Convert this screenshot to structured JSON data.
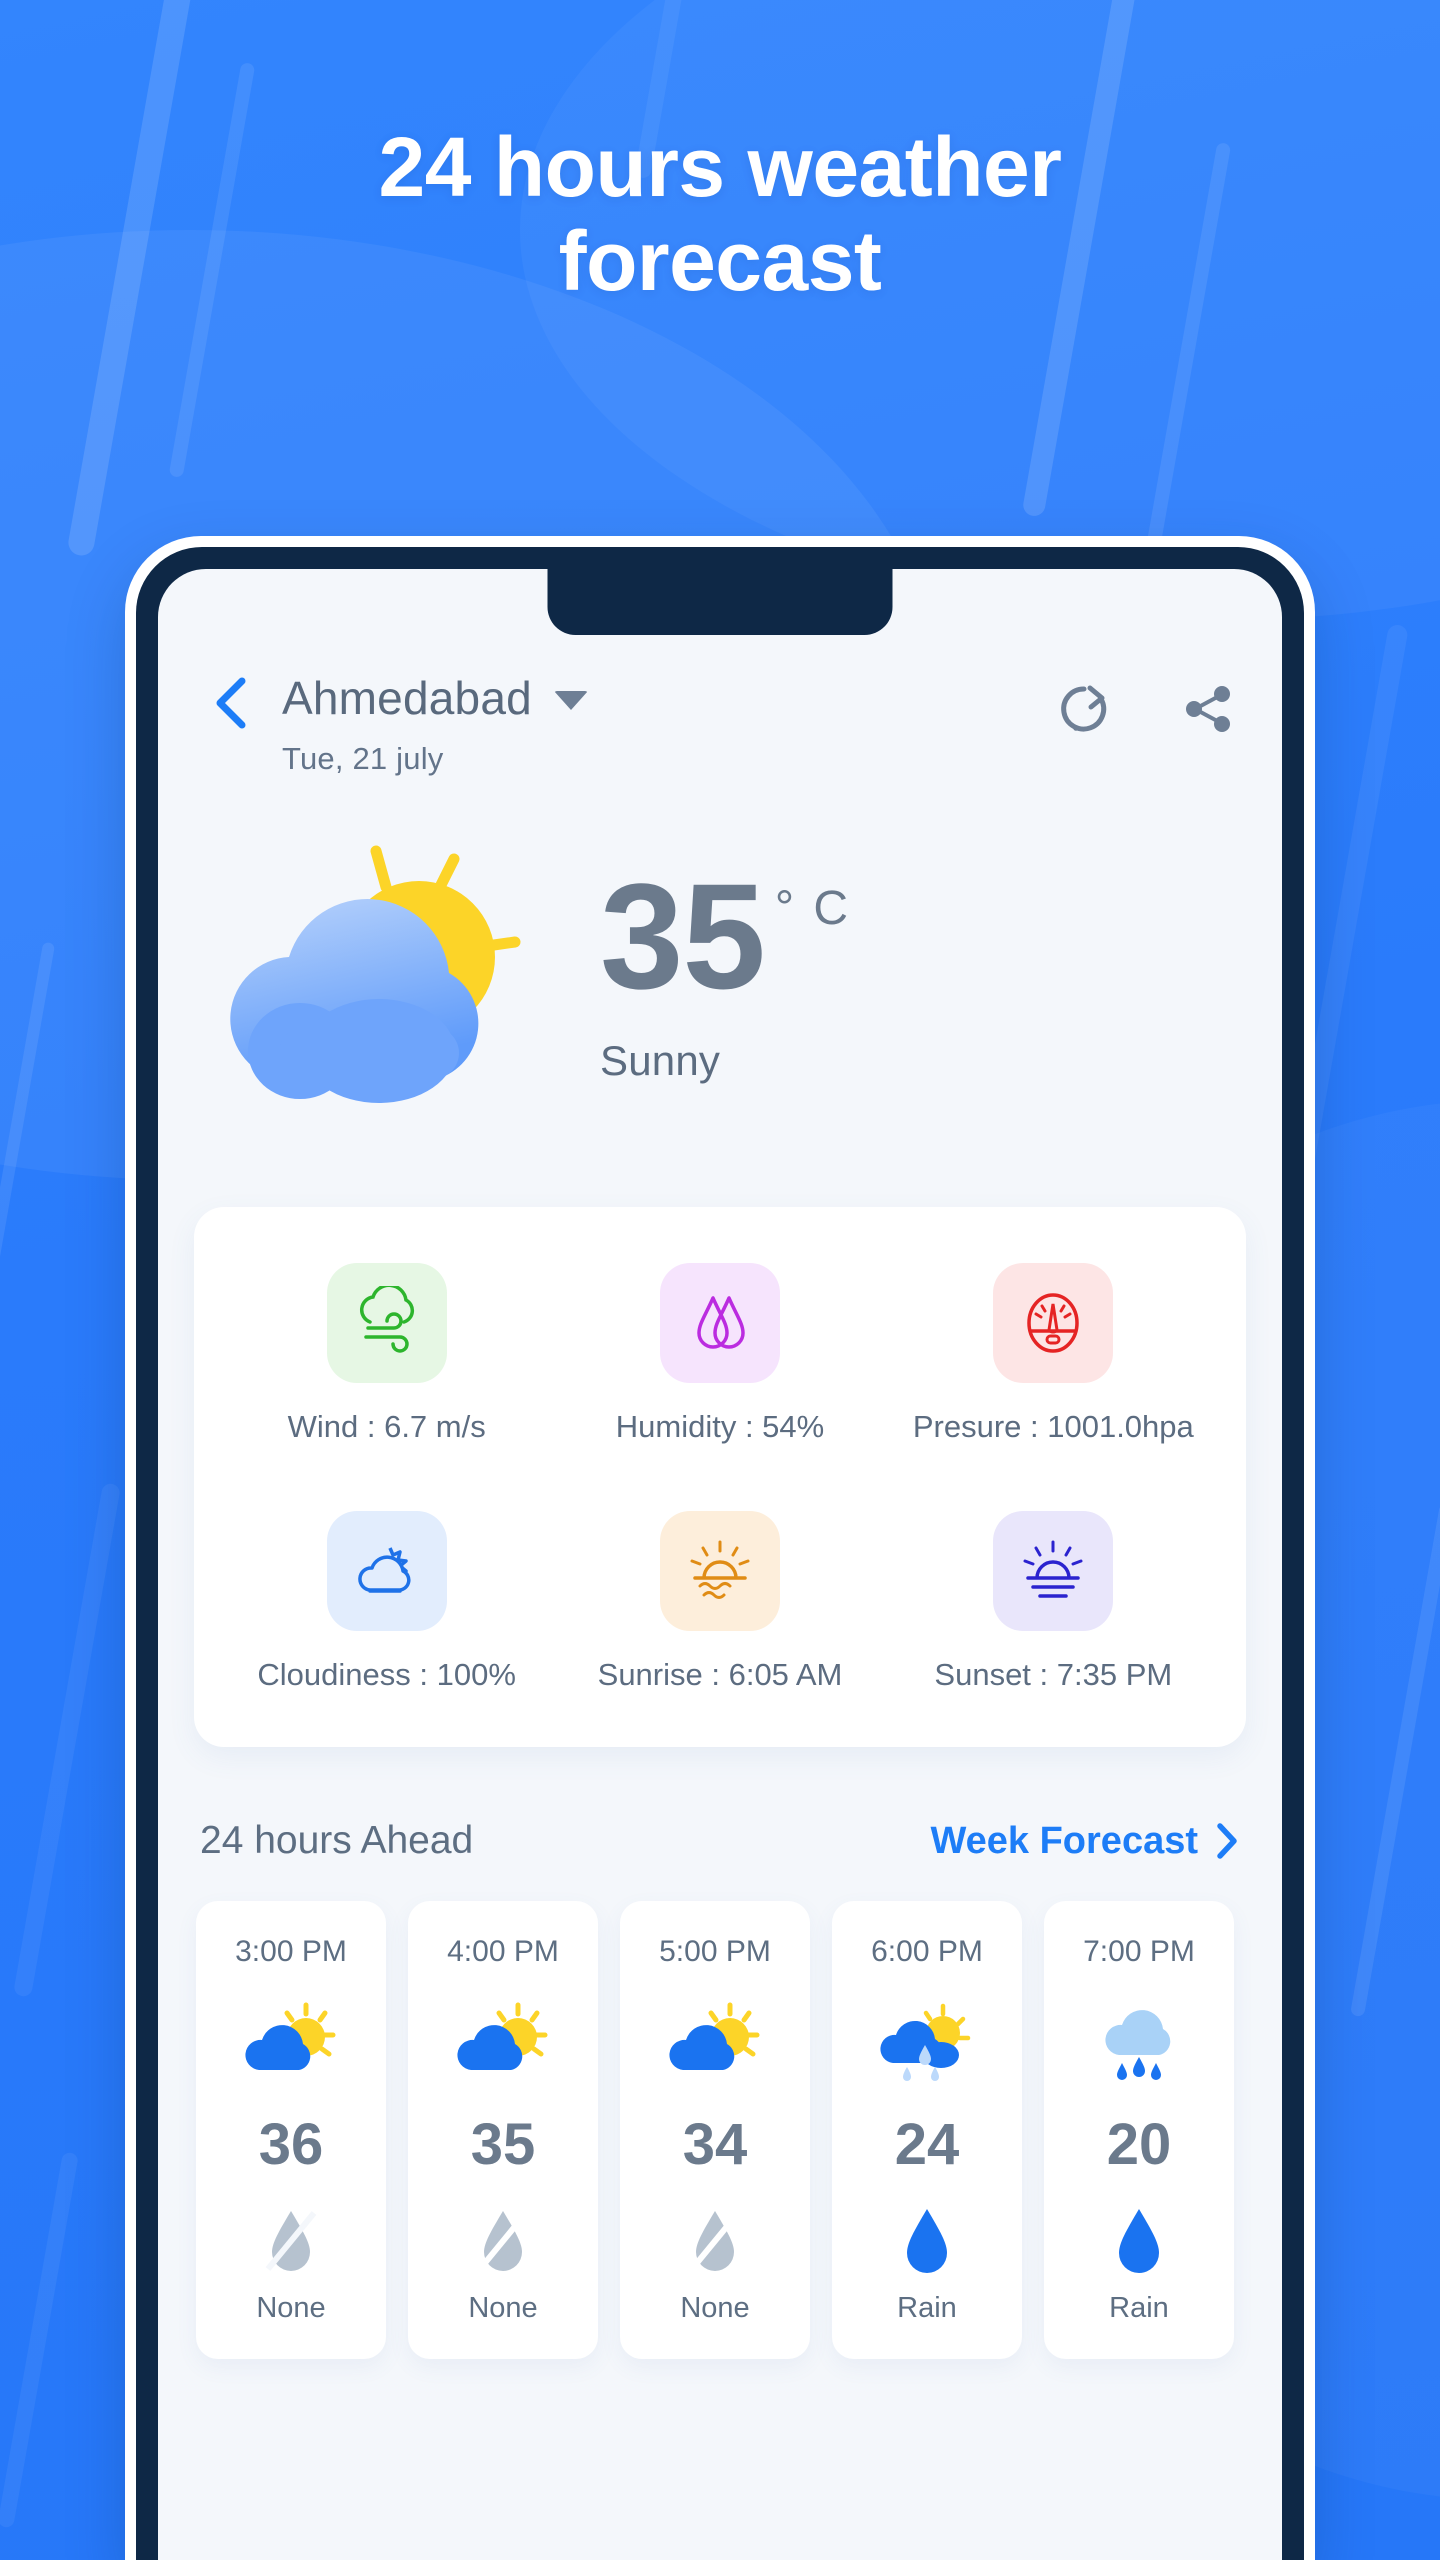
{
  "promo": {
    "headline_line1": "24 hours weather",
    "headline_line2": "forecast"
  },
  "app": {
    "header": {
      "back_icon": "chevron-left-icon",
      "city": "Ahmedabad",
      "city_dropdown_icon": "chevron-down-icon",
      "date": "Tue, 21 july",
      "refresh_icon": "refresh-icon",
      "share_icon": "share-icon"
    },
    "current": {
      "weather_icon": "sun-behind-cloud-icon",
      "temperature": "35",
      "unit": "° C",
      "condition": "Sunny"
    },
    "metrics": [
      {
        "icon": "wind-icon",
        "label": "Wind : 6.7 m/s",
        "tile_bg": "#e6f7e4",
        "icon_color": "#2db52d"
      },
      {
        "icon": "humidity-icon",
        "label": "Humidity : 54%",
        "tile_bg": "#f6e4fd",
        "icon_color": "#bb2ce0"
      },
      {
        "icon": "pressure-icon",
        "label": "Presure : 1001.0hpa",
        "tile_bg": "#fde5e5",
        "icon_color": "#e52424"
      },
      {
        "icon": "cloudiness-icon",
        "label": "Cloudiness : 100%",
        "tile_bg": "#e2edfd",
        "icon_color": "#1f72e8"
      },
      {
        "icon": "sunrise-icon",
        "label": "Sunrise : 6:05 AM",
        "tile_bg": "#fdeedb",
        "icon_color": "#e08c15"
      },
      {
        "icon": "sunset-icon",
        "label": "Sunset : 7:35 PM",
        "tile_bg": "#e9e6fb",
        "icon_color": "#2b23cf"
      }
    ],
    "hourly_section": {
      "title": "24 hours Ahead",
      "week_link_label": "Week Forecast",
      "week_link_icon": "chevron-right-icon",
      "hours": [
        {
          "time": "3:00 PM",
          "icon": "sun-cloud-icon",
          "temp": "36",
          "precip_icon": "no-rain-drop-icon",
          "precip": "None"
        },
        {
          "time": "4:00 PM",
          "icon": "sun-cloud-icon",
          "temp": "35",
          "precip_icon": "no-rain-drop-icon",
          "precip": "None"
        },
        {
          "time": "5:00 PM",
          "icon": "sun-cloud-icon",
          "temp": "34",
          "precip_icon": "no-rain-drop-icon",
          "precip": "None"
        },
        {
          "time": "6:00 PM",
          "icon": "sun-rain-cloud-icon",
          "temp": "24",
          "precip_icon": "rain-drop-icon",
          "precip": "Rain"
        },
        {
          "time": "7:00 PM",
          "icon": "rain-cloud-icon",
          "temp": "20",
          "precip_icon": "rain-drop-icon",
          "precip": "Rain"
        }
      ]
    }
  },
  "colors": {
    "promo_bg": "#2e7ffb",
    "accent_blue": "#1d7df7",
    "bezel": "#0e2846",
    "screen_bg": "#f4f7fb",
    "text_grey": "#5d6e82"
  }
}
